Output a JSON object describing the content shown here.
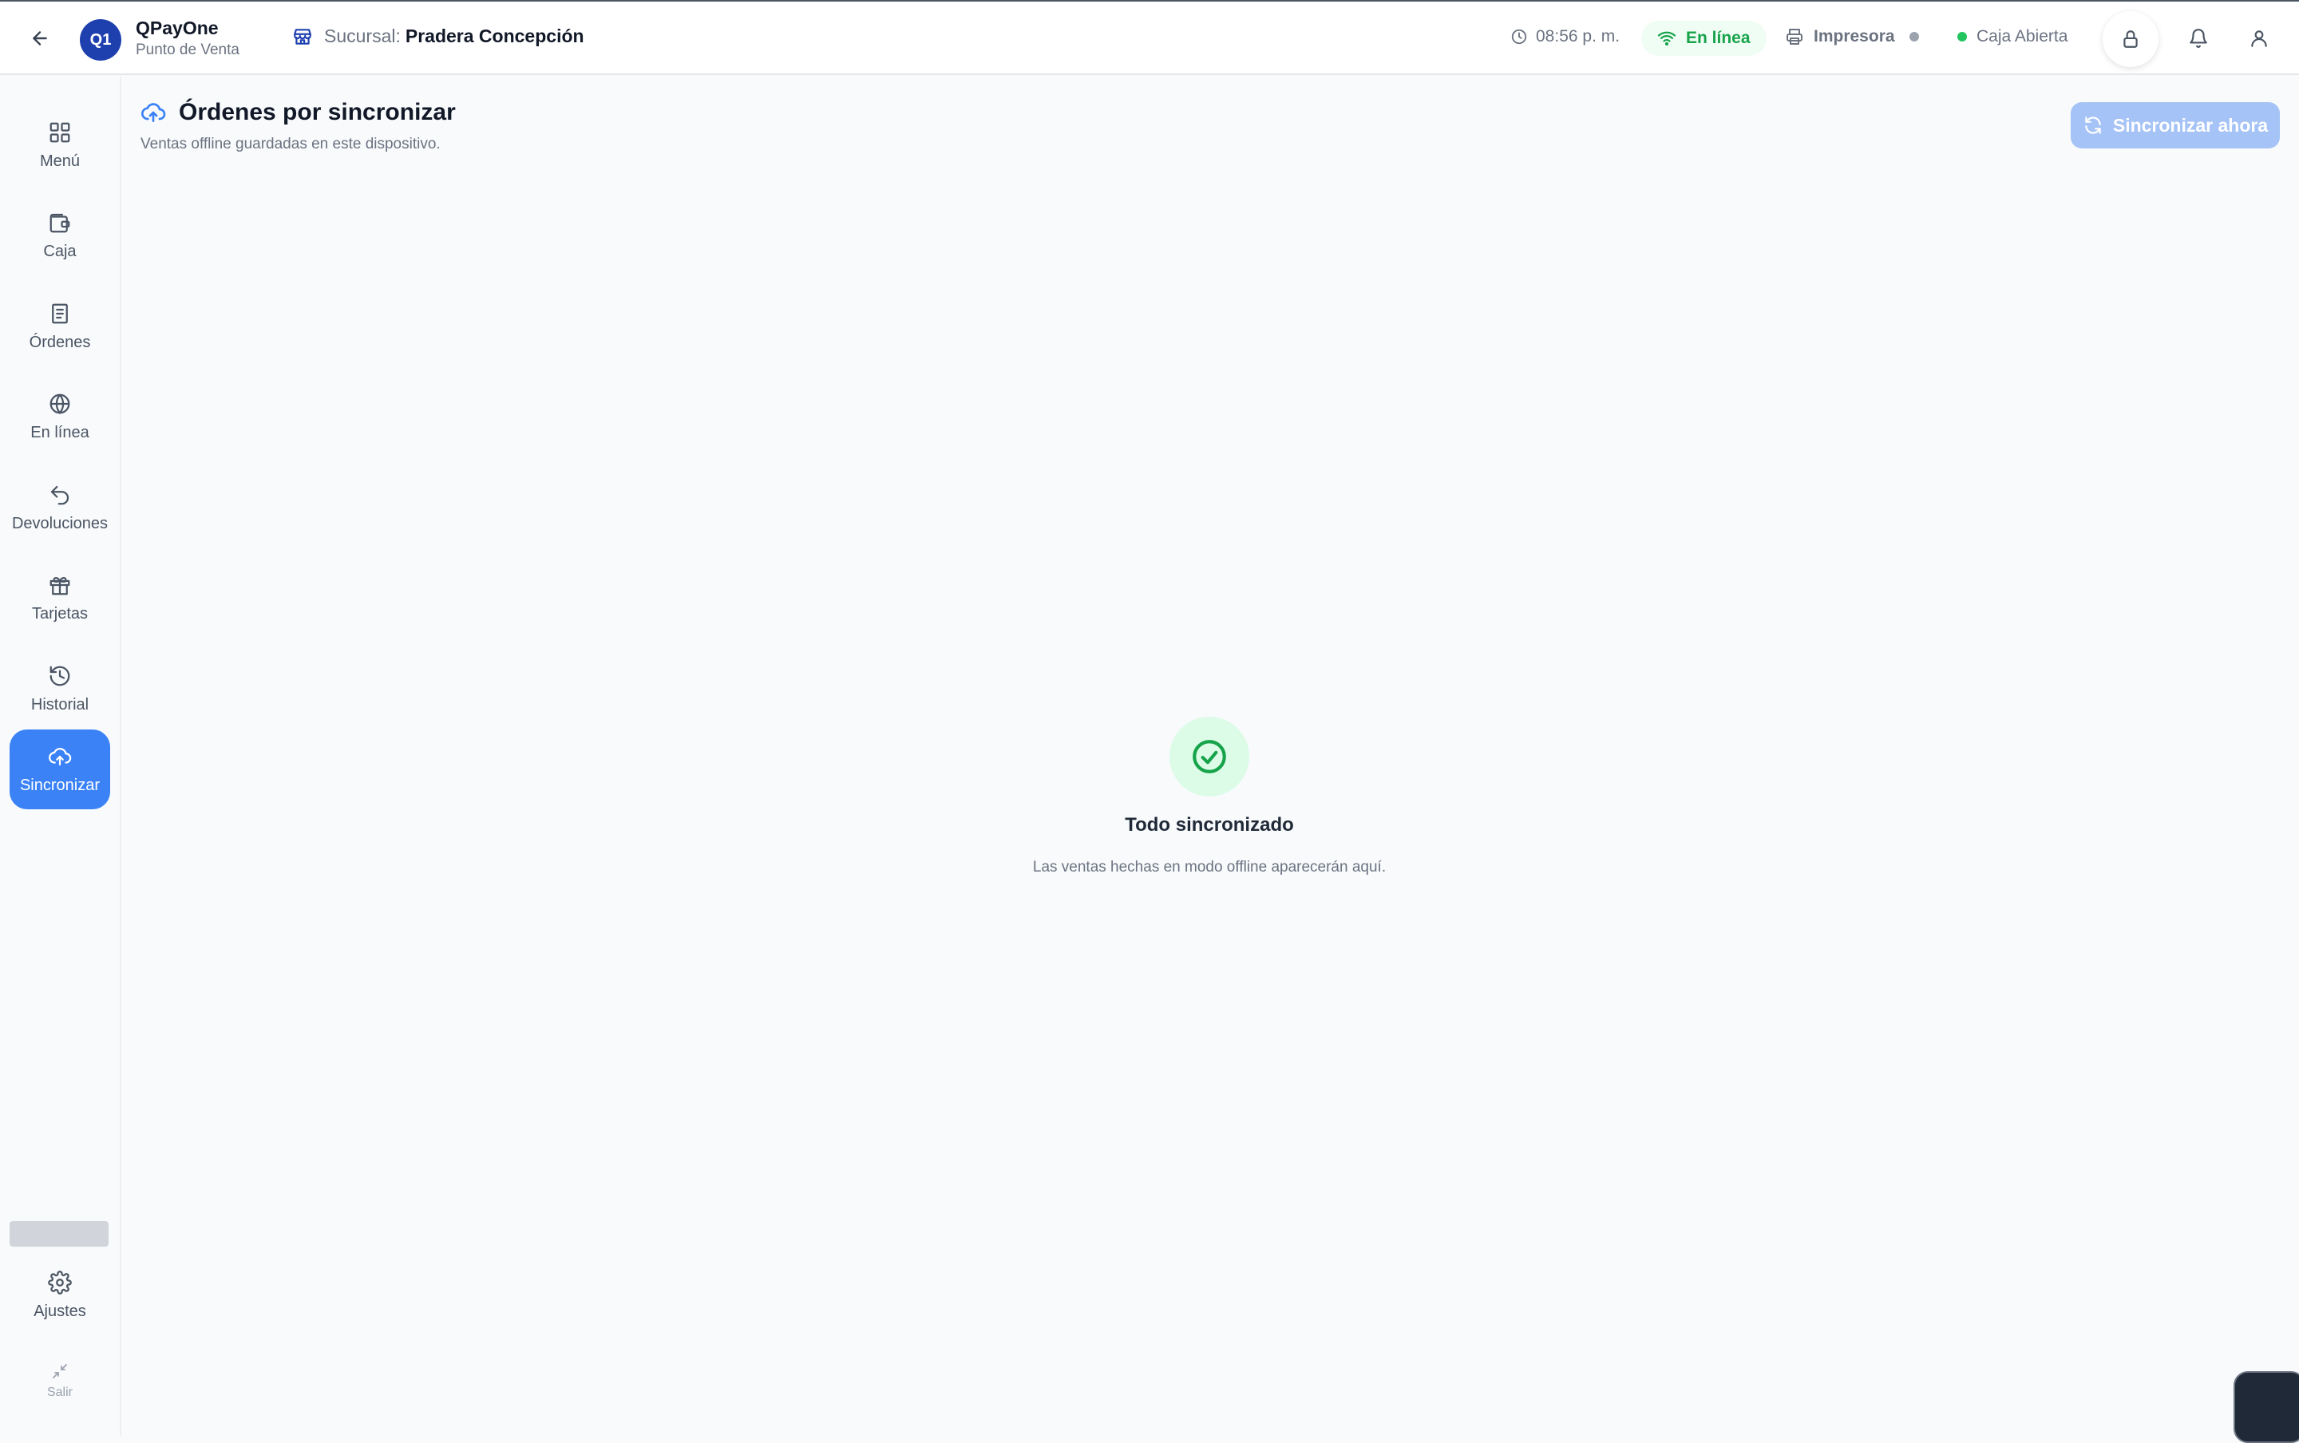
{
  "header": {
    "logo_text": "Q1",
    "brand_name": "QPayOne",
    "brand_subtitle": "Punto de Venta",
    "branch_label": "Sucursal:",
    "branch_name": "Pradera Concepción",
    "time": "08:56 p. m.",
    "connection_status": "En línea",
    "printer_label": "Impresora",
    "register_status": "Caja Abierta"
  },
  "sidebar": {
    "items": [
      {
        "label": "Menú",
        "icon": "grid-icon"
      },
      {
        "label": "Caja",
        "icon": "wallet-icon"
      },
      {
        "label": "Órdenes",
        "icon": "receipt-icon"
      },
      {
        "label": "En línea",
        "icon": "globe-icon"
      },
      {
        "label": "Devoluciones",
        "icon": "undo-icon"
      },
      {
        "label": "Tarjetas",
        "icon": "gift-icon"
      },
      {
        "label": "Historial",
        "icon": "history-icon"
      },
      {
        "label": "Sincronizar",
        "icon": "cloud-upload-icon",
        "active": true
      }
    ],
    "settings_label": "Ajustes",
    "exit_label": "Salir"
  },
  "main": {
    "title": "Órdenes por sincronizar",
    "subtitle": "Ventas offline guardadas en este dispositivo.",
    "sync_button_label": "Sincronizar ahora",
    "empty_title": "Todo sincronizado",
    "empty_description": "Las ventas hechas en modo offline aparecerán aquí."
  },
  "colors": {
    "accent": "#3b82f6",
    "brand": "#1e40af",
    "online": "#16a34a",
    "success_bg": "#dcfce7"
  }
}
